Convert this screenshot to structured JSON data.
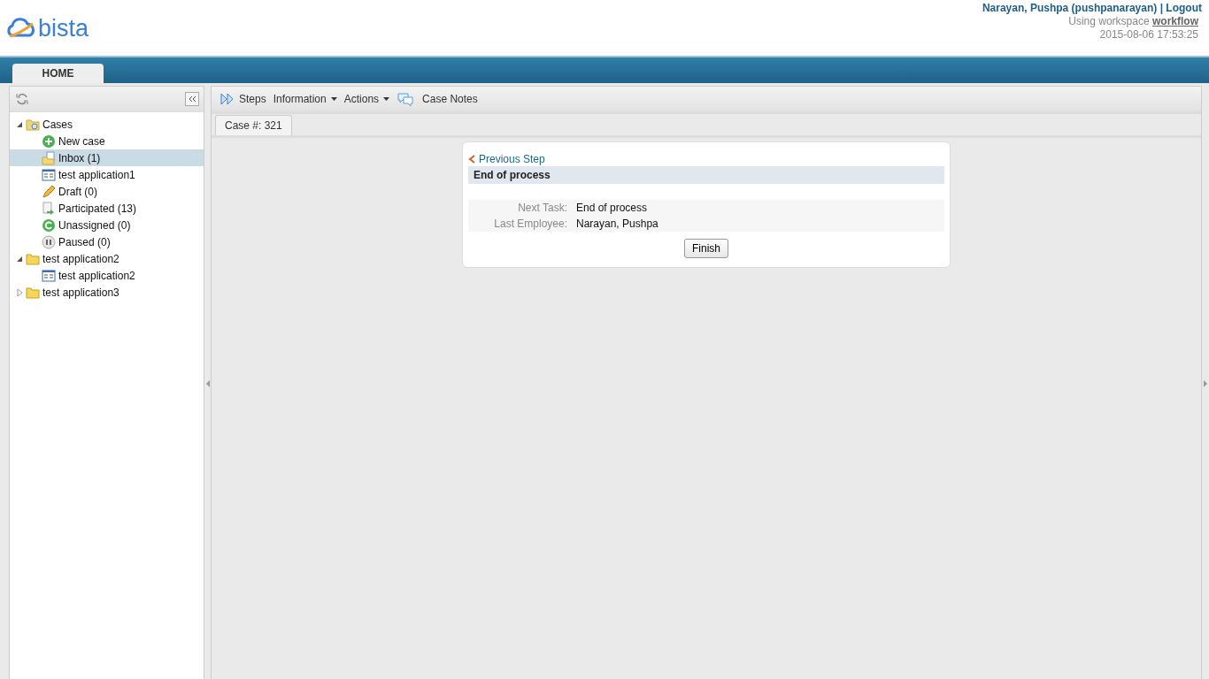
{
  "header": {
    "logo_text": "bista",
    "user": "Narayan, Pushpa (pushpanarayan)",
    "separator": "|",
    "logout": "Logout",
    "workspace_prefix": "Using workspace",
    "workspace": "workflow",
    "datetime": "2015-08-06 17:53:25"
  },
  "nav_tabs": [
    {
      "label": "HOME",
      "selected": true
    }
  ],
  "tree": [
    {
      "label": "Cases",
      "kind": "cases",
      "selected": false,
      "expanded": true,
      "children": [
        {
          "label": "New case",
          "kind": "new",
          "selected": false
        },
        {
          "label": "Inbox (1)",
          "kind": "inbox",
          "selected": true
        },
        {
          "label": "test application1",
          "kind": "form",
          "selected": false
        },
        {
          "label": "Draft (0)",
          "kind": "draft",
          "selected": false
        },
        {
          "label": "Participated (13)",
          "kind": "participated",
          "selected": false
        },
        {
          "label": "Unassigned (0)",
          "kind": "unassigned",
          "selected": false
        },
        {
          "label": "Paused (0)",
          "kind": "paused",
          "selected": false
        }
      ]
    },
    {
      "label": "test application2",
      "kind": "folder",
      "selected": false,
      "expanded": true,
      "children": [
        {
          "label": "test application2",
          "kind": "form",
          "selected": false
        }
      ]
    },
    {
      "label": "test application3",
      "kind": "folder",
      "selected": false,
      "expanded": false
    }
  ],
  "toolbar": [
    {
      "label": "Steps",
      "kind": "steps"
    },
    {
      "label": "Information",
      "kind": "menu"
    },
    {
      "label": "Actions",
      "kind": "menu"
    },
    {
      "label": "Case Notes",
      "kind": "notes"
    }
  ],
  "case_tabs": [
    {
      "label": "Case #: 321",
      "selected": true
    }
  ],
  "step": {
    "previous": "Previous Step",
    "title": "End of process",
    "fields": [
      {
        "label": "Next Task:",
        "value": "End of process"
      },
      {
        "label": "Last Employee:",
        "value": "Narayan, Pushpa"
      }
    ],
    "button": "Finish"
  }
}
